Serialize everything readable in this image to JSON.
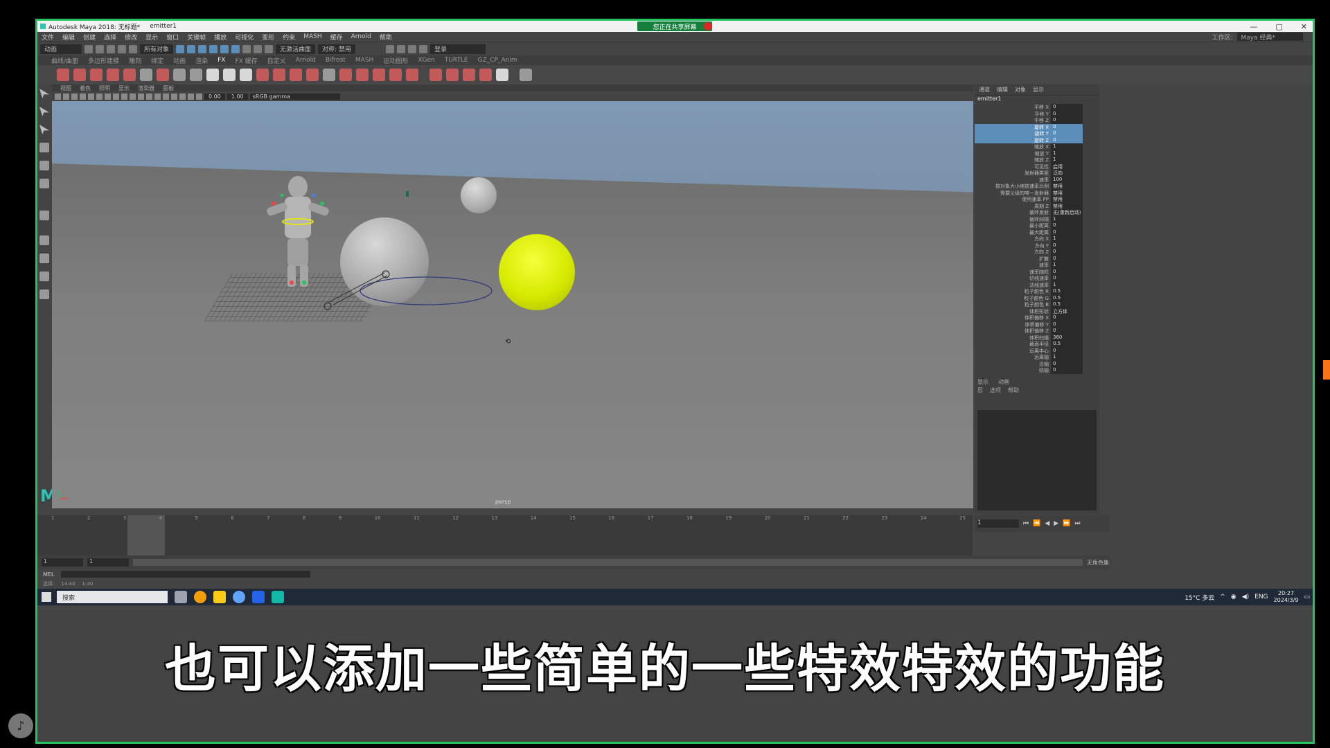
{
  "window": {
    "title": "Autodesk Maya 2018: 无标题*",
    "file": "emitter1",
    "share_badge": "您正在共享屏幕",
    "controls": [
      "—",
      "▢",
      "✕"
    ]
  },
  "menubar": {
    "items": [
      "文件",
      "编辑",
      "创建",
      "选择",
      "修改",
      "显示",
      "窗口",
      "关键帧",
      "播放",
      "可视化",
      "变形",
      "约束",
      "MASH",
      "缓存",
      "Arnold",
      "帮助"
    ],
    "workspace_label": "工作区:",
    "workspace_value": "Maya 经典*"
  },
  "statusline": {
    "mode": "动画",
    "selection_label": "所有对象",
    "symmetry": "无激活曲面",
    "symmetry2": "对称: 禁用",
    "login": "登录"
  },
  "shelf": {
    "tabs": [
      "曲线/曲面",
      "多边形建模",
      "雕刻",
      "绑定",
      "动画",
      "渲染",
      "FX",
      "FX 缓存",
      "自定义",
      "Arnold",
      "Bifrost",
      "MASH",
      "运动图形",
      "XGen",
      "TURTLE",
      "GZ_CP_Anim"
    ],
    "active_tab": "FX"
  },
  "viewport": {
    "menus": [
      "视图",
      "着色",
      "照明",
      "显示",
      "渲染器",
      "面板"
    ],
    "exposure": "0.00",
    "gamma": "1.00",
    "color_space": "sRGB gamma",
    "camera_label": "persp"
  },
  "channel_box": {
    "tabs": [
      "通道",
      "编辑",
      "对象",
      "显示"
    ],
    "node": "emitter1",
    "attrs": [
      {
        "n": "平移 X",
        "v": "0"
      },
      {
        "n": "平移 Y",
        "v": "0"
      },
      {
        "n": "平移 Z",
        "v": "0"
      },
      {
        "n": "旋转 X",
        "v": "0",
        "sel": true
      },
      {
        "n": "旋转 Y",
        "v": "0",
        "sel": true
      },
      {
        "n": "旋转 Z",
        "v": "0",
        "sel": true
      },
      {
        "n": "缩放 X",
        "v": "1"
      },
      {
        "n": "缩放 Y",
        "v": "1"
      },
      {
        "n": "缩放 Z",
        "v": "1"
      },
      {
        "n": "可见性",
        "v": "启用"
      },
      {
        "n": "发射器类型",
        "v": "泛向"
      },
      {
        "n": "速率",
        "v": "100"
      },
      {
        "n": "按对象大小缩放速率比例",
        "v": "禁用"
      },
      {
        "n": "需要父级的唯一发射器",
        "v": "禁用"
      },
      {
        "n": "使用速率 PP",
        "v": "禁用"
      },
      {
        "n": "周期 Z",
        "v": "禁用"
      },
      {
        "n": "循环发射",
        "v": "无(重新启动)"
      },
      {
        "n": "循环间隔",
        "v": "1"
      },
      {
        "n": "最小距离",
        "v": "0"
      },
      {
        "n": "最大距离",
        "v": "0"
      },
      {
        "n": "方向 X",
        "v": "1"
      },
      {
        "n": "方向 Y",
        "v": "0"
      },
      {
        "n": "方向 Z",
        "v": "0"
      },
      {
        "n": "扩散",
        "v": "0"
      },
      {
        "n": "速率",
        "v": "1"
      },
      {
        "n": "速率随机",
        "v": "0"
      },
      {
        "n": "切线速率",
        "v": "0"
      },
      {
        "n": "法线速率",
        "v": "1"
      },
      {
        "n": "粒子颜色 R",
        "v": "0.5"
      },
      {
        "n": "粒子颜色 G",
        "v": "0.5"
      },
      {
        "n": "粒子颜色 B",
        "v": "0.5"
      },
      {
        "n": "体积形状",
        "v": "立方体"
      },
      {
        "n": "体积偏移 X",
        "v": "0"
      },
      {
        "n": "体积偏移 Y",
        "v": "0"
      },
      {
        "n": "体积偏移 Z",
        "v": "0"
      },
      {
        "n": "体积扫描",
        "v": "360"
      },
      {
        "n": "截面半径",
        "v": "0.5"
      },
      {
        "n": "远离中心",
        "v": "0"
      },
      {
        "n": "远离轴",
        "v": "1"
      },
      {
        "n": "沿轴",
        "v": "0"
      },
      {
        "n": "绕轴",
        "v": "0"
      }
    ]
  },
  "layer_editor": {
    "tabs": [
      "显示",
      "动画"
    ],
    "menus": [
      "层",
      "选项",
      "帮助"
    ]
  },
  "timeline": {
    "ticks": [
      "1",
      "2",
      "3",
      "4",
      "5",
      "6",
      "7",
      "8",
      "9",
      "10",
      "11",
      "12",
      "13",
      "14",
      "15",
      "16",
      "17",
      "18",
      "19",
      "20",
      "21",
      "22",
      "23",
      "24",
      "25"
    ],
    "current_frame": "1",
    "range_start": "1",
    "range_inner": "1",
    "range_end_label": "无角色集"
  },
  "cmdline": {
    "label": "MEL"
  },
  "helpline": {
    "items": [
      "选择:",
      "14:40",
      "1:40"
    ]
  },
  "taskbar": {
    "search": "搜索",
    "weather": "15°C 多云",
    "lang": "ENG",
    "time": "20:27",
    "date": "2024/3/9"
  },
  "subtitle": "也可以添加一些简单的一些特效特效的功能"
}
